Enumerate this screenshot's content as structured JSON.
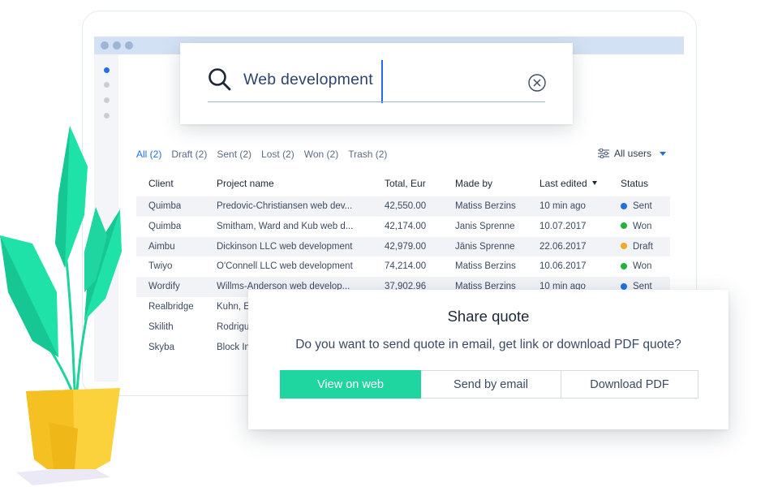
{
  "search": {
    "query": "Web development"
  },
  "filters": {
    "tabs": [
      {
        "label": "All (2)"
      },
      {
        "label": "Draft (2)"
      },
      {
        "label": "Sent (2)"
      },
      {
        "label": "Lost (2)"
      },
      {
        "label": "Won (2)"
      },
      {
        "label": "Trash (2)"
      }
    ],
    "active_tab": "All (2)",
    "users_label": "All users"
  },
  "table": {
    "columns": {
      "client": "Client",
      "project": "Project name",
      "total": "Total, Eur",
      "made_by": "Made by",
      "last_edited": "Last edited",
      "status": "Status"
    },
    "rows": [
      {
        "client": "Quimba",
        "project": "Predovic-Christiansen web dev...",
        "total": "42,550.00",
        "made_by": "Matiss Berzins",
        "last_edited": "10 min ago",
        "status": "Sent",
        "status_color": "#1f6fe5"
      },
      {
        "client": "Quimba",
        "project": "Smitham, Ward and Kub web d...",
        "total": "42,174.00",
        "made_by": "Janis Sprenne",
        "last_edited": "10.07.2017",
        "status": "Won",
        "status_color": "#20b23a"
      },
      {
        "client": "Aimbu",
        "project": "Dickinson LLC web development",
        "total": "42,979.00",
        "made_by": "Jānis Sprenne",
        "last_edited": "22.06.2017",
        "status": "Draft",
        "status_color": "#f5a623"
      },
      {
        "client": "Twiyo",
        "project": "O'Connell LLC web development",
        "total": "74,214.00",
        "made_by": "Matiss Berzins",
        "last_edited": "10.06.2017",
        "status": "Won",
        "status_color": "#20b23a"
      },
      {
        "client": "Wordify",
        "project": "Willms-Anderson web develop...",
        "total": "37,902.96",
        "made_by": "Matiss Berzins",
        "last_edited": "10 min ago",
        "status": "Sent",
        "status_color": "#1f6fe5"
      },
      {
        "client": "Realbridge",
        "project": "Kuhn, E",
        "total": "",
        "made_by": "",
        "last_edited": "",
        "status": "",
        "status_color": ""
      },
      {
        "client": "Skilith",
        "project": "Rodrigu",
        "total": "",
        "made_by": "",
        "last_edited": "",
        "status": "",
        "status_color": ""
      },
      {
        "client": "Skyba",
        "project": "Block In",
        "total": "",
        "made_by": "",
        "last_edited": "",
        "status": "",
        "status_color": ""
      }
    ]
  },
  "share": {
    "title": "Share quote",
    "question": "Do you want to send quote in email, get link or download PDF quote?",
    "buttons": {
      "web": "View on web",
      "email": "Send by email",
      "pdf": "Download PDF"
    }
  },
  "colors": {
    "accent": "#1f6fe5",
    "primary_button": "#1fd6a0",
    "titlebar": "#d3e1f4"
  }
}
